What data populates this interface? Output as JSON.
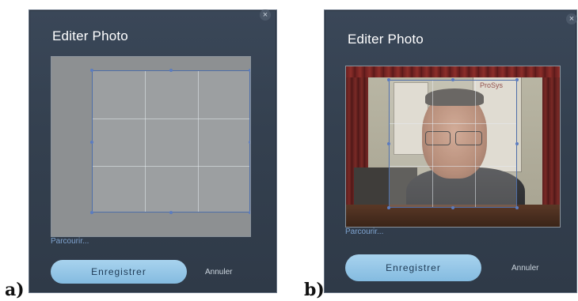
{
  "panels": [
    {
      "label": "a)",
      "dialog": {
        "title": "Editer Photo",
        "close_glyph": "×",
        "browse_label": "Parcourir...",
        "save_label": "Enregistrer",
        "cancel_label": "Annuler"
      }
    },
    {
      "label": "b)",
      "dialog": {
        "title": "Editer Photo",
        "close_glyph": "×",
        "browse_label": "Parcourir...",
        "save_label": "Enregistrer",
        "cancel_label": "Annuler",
        "poster_text": "ProSys"
      }
    }
  ],
  "icons": {
    "close": "close-icon"
  },
  "colors": {
    "dialog_bg": "#36424f",
    "accent_button": "#94c6e6",
    "link": "#7fa3cf",
    "crop_border": "#4e6ea8"
  }
}
